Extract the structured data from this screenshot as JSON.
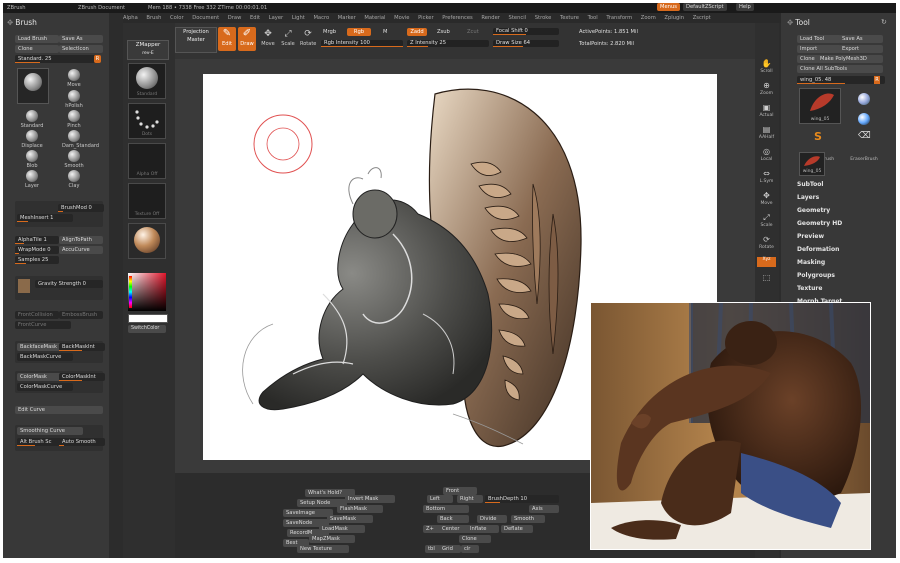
{
  "topbar": {
    "app": "ZBrush",
    "document": "ZBrush Document",
    "mem": "Mem 188 • 7338 Free 332 ZTime 00:00:01.01",
    "menus": "Menus",
    "script": "DefaultZScript",
    "help": "Help"
  },
  "menubar": [
    "Alpha",
    "Brush",
    "Color",
    "Document",
    "Draw",
    "Edit",
    "Layer",
    "Light",
    "Macro",
    "Marker",
    "Material",
    "Movie",
    "Picker",
    "Preferences",
    "Render",
    "Stencil",
    "Stroke",
    "Texture",
    "Tool",
    "Transform",
    "Zoom",
    "Zplugin",
    "Zscript"
  ],
  "brush_palette": {
    "title": "Brush",
    "load": "Load Brush",
    "save": "Save As",
    "clone": "Clone",
    "select_icon": "SelectIcon",
    "current": "Standard. 25",
    "brushes": [
      "Standard",
      "Move",
      "Standard",
      "hPolish",
      "Standard",
      "Pinch",
      "Displace",
      "Dam_Standard",
      "Blob",
      "Smooth",
      "Layer",
      "Clay"
    ],
    "brush_mod": "BrushMod 0",
    "mesh_insert": "MeshInsert 1",
    "alpha_tile": "AlphaTile 1",
    "align_to_path": "AlignToPath",
    "wrap_mode": "WrapMode 0",
    "accu_curve": "AccuCurve",
    "samples": "Samples 25",
    "gravity": "Gravity Strength 0",
    "frontcollision": "FrontCollision",
    "embossbrush": "EmbossBrush",
    "frontcurve": "FrontCurve",
    "backface_mask": "BackfaceMask",
    "backmask_int": "BackMaskInt",
    "backmask_curve": "BackMaskCurve",
    "colormask": "ColorMask",
    "colormask_int": "ColorMaskInt",
    "colormask_curve": "ColorMaskCurve",
    "edit_curve": "Edit Curve",
    "smoothing_curve": "Smoothing Curve",
    "alt_brush": "Alt Brush Sc",
    "auto_smooth": "Auto Smooth"
  },
  "shelf": {
    "zmapper": "ZMapper",
    "zmapper_sub": "rev-E",
    "thumbs": [
      "Standard",
      "Dots",
      "Alpha Off",
      "Texture Off",
      "MatCap"
    ],
    "switch_color": "SwitchColor"
  },
  "toolbar": {
    "projection": "Projection",
    "master": "Master",
    "edit": "Edit",
    "draw": "Draw",
    "move": "Move",
    "scale": "Scale",
    "rotate": "Rotate",
    "mrgb": "Mrgb",
    "rgb": "Rgb",
    "m": "M",
    "zadd": "Zadd",
    "zsub": "Zsub",
    "zcut": "Zcut",
    "rgb_intensity": "Rgb Intensity 100",
    "z_intensity": "Z Intensity 25",
    "focal_shift": "Focal Shift 0",
    "draw_size": "Draw Size 64",
    "active_points": "ActivePoints: 1.851 Mil",
    "total_points": "TotalPoints: 2.820 Mil"
  },
  "tool_palette": {
    "title": "Tool",
    "load": "Load Tool",
    "save": "Save As",
    "import": "Import",
    "export": "Export",
    "clone": "Clone",
    "make_polymesh": "Make PolyMesh3D",
    "clone_all": "Clone All SubTools",
    "current": "wing_05. 48",
    "tools": [
      "wing_05",
      "SphereBrush",
      "AlphaBrush",
      "SimpleBrush",
      "EraserBrush",
      "wing_05"
    ],
    "sections": [
      "SubTool",
      "Layers",
      "Geometry",
      "Geometry HD",
      "Preview",
      "Deformation",
      "Masking",
      "Polygroups",
      "Texture",
      "Morph Target"
    ]
  },
  "right_shelf": [
    "Scroll",
    "Zoom",
    "Actual",
    "AAHalf",
    "Local",
    "L.Sym",
    "Move",
    "Scale",
    "Rotate",
    "Xyz",
    "Frame"
  ],
  "bottom": {
    "left_col": [
      "What's Hold?",
      "Setup Node",
      "SaveImage",
      "SaveNode",
      "RecordM",
      "Best",
      "New Texture"
    ],
    "mid_col": [
      "Invert Mask",
      "FlashMask",
      "SaveMask",
      "LoadMask",
      "MapZMask"
    ],
    "right_col": [
      "Front",
      "Left",
      "Right",
      "Back",
      "BrushDepth 10",
      "Bottom",
      "Axis",
      "Divide",
      "Smooth",
      "Z+",
      "Center",
      "Inflate",
      "Deflate",
      "Clone",
      "tbl",
      "Grid",
      "clr"
    ]
  },
  "colors": {
    "accent": "#d86a1c",
    "panel": "#383838",
    "background": "#2c2c2c"
  }
}
